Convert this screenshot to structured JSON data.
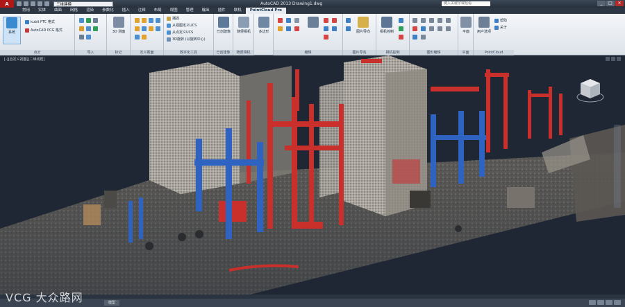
{
  "titlebar": {
    "workspace": "三维建模",
    "window_title": "AutoCAD 2013  Drawing1.dwg",
    "search_placeholder": "键入关键字或短语"
  },
  "tabs": [
    {
      "label": "常用"
    },
    {
      "label": "实体"
    },
    {
      "label": "曲面"
    },
    {
      "label": "网格"
    },
    {
      "label": "渲染"
    },
    {
      "label": "参数化"
    },
    {
      "label": "插入"
    },
    {
      "label": "注释"
    },
    {
      "label": "布局"
    },
    {
      "label": "视图"
    },
    {
      "label": "管理"
    },
    {
      "label": "输出"
    },
    {
      "label": "插件"
    },
    {
      "label": "联机"
    },
    {
      "label": "PointCloud Pro"
    }
  ],
  "active_tab": "PointCloud Pro",
  "ribbon": {
    "import_big": "系统",
    "kubit_ptc": "kubit PTC 格式",
    "autocad_pcg": "AutoCAD PCG 格式",
    "panel_points": "点云",
    "panel_import": "导入",
    "panel_markers": "标记",
    "panel_3d": "3D 测面",
    "panel_section": "定义截面",
    "panel_tools": "数字化工具",
    "ucs_1": "捕捉",
    "ucs_2": "从视图定义UCS",
    "ucs_3": "从点定义UCS",
    "ucs_4": "3D旋转 (以旋转中心)",
    "panel_virtual": "已创建像",
    "panel_surface": "随便相机",
    "panel_more": "多边形",
    "panel_edit": "编辑",
    "panel_image_import": "图片导向",
    "image_btn": "图片导向",
    "camera": "相机控制",
    "camera_btn": "相机控制",
    "panel_draw": "图形编辑",
    "panel_layout": "平面",
    "user_prefs": "用户选项",
    "help_1": "帮助",
    "help_2": "关于",
    "panel_pointcloud": "PointCloud"
  },
  "viewport": {
    "label": "[-][自定义视图][二维线框]"
  },
  "statusbar": {
    "model_tab": "模型"
  },
  "watermark": "VCG 大众路网"
}
